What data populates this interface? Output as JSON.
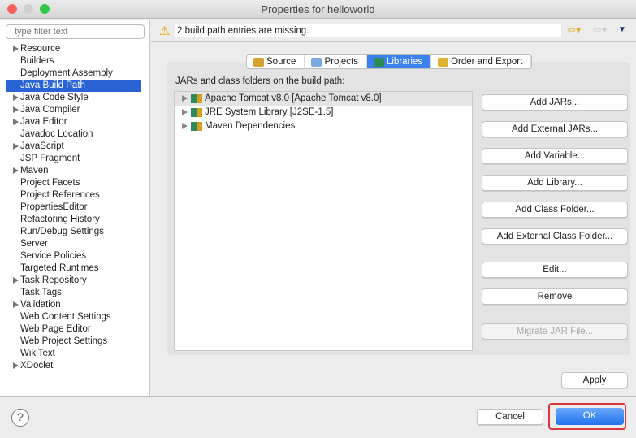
{
  "window": {
    "title": "Properties for helloworld"
  },
  "filter": {
    "placeholder": "type filter text"
  },
  "sidebar": {
    "items": [
      {
        "label": "Resource",
        "expandable": true
      },
      {
        "label": "Builders"
      },
      {
        "label": "Deployment Assembly"
      },
      {
        "label": "Java Build Path",
        "selected": true
      },
      {
        "label": "Java Code Style",
        "expandable": true
      },
      {
        "label": "Java Compiler",
        "expandable": true
      },
      {
        "label": "Java Editor",
        "expandable": true
      },
      {
        "label": "Javadoc Location"
      },
      {
        "label": "JavaScript",
        "expandable": true
      },
      {
        "label": "JSP Fragment"
      },
      {
        "label": "Maven",
        "expandable": true
      },
      {
        "label": "Project Facets"
      },
      {
        "label": "Project References"
      },
      {
        "label": "PropertiesEditor"
      },
      {
        "label": "Refactoring History"
      },
      {
        "label": "Run/Debug Settings"
      },
      {
        "label": "Server"
      },
      {
        "label": "Service Policies"
      },
      {
        "label": "Targeted Runtimes"
      },
      {
        "label": "Task Repository",
        "expandable": true
      },
      {
        "label": "Task Tags"
      },
      {
        "label": "Validation",
        "expandable": true
      },
      {
        "label": "Web Content Settings"
      },
      {
        "label": "Web Page Editor"
      },
      {
        "label": "Web Project Settings"
      },
      {
        "label": "WikiText"
      },
      {
        "label": "XDoclet",
        "expandable": true
      }
    ]
  },
  "message": {
    "text": "2 build path entries are missing.",
    "icon": "warning-icon"
  },
  "tabs": [
    {
      "label": "Source",
      "icon": "source-folder-icon"
    },
    {
      "label": "Projects",
      "icon": "folder-icon"
    },
    {
      "label": "Libraries",
      "icon": "library-icon",
      "active": true
    },
    {
      "label": "Order and Export",
      "icon": "order-icon"
    }
  ],
  "main": {
    "label": "JARs and class folders on the build path:",
    "entries": [
      "Apache Tomcat v8.0 [Apache Tomcat v8.0]",
      "JRE System Library [J2SE-1.5]",
      "Maven Dependencies"
    ],
    "buttons": [
      {
        "label": "Add JARs..."
      },
      {
        "label": "Add External JARs..."
      },
      {
        "label": "Add Variable..."
      },
      {
        "label": "Add Library..."
      },
      {
        "label": "Add Class Folder..."
      },
      {
        "label": "Add External Class Folder..."
      },
      {
        "label": "Edit..."
      },
      {
        "label": "Remove"
      },
      {
        "label": "Migrate JAR File...",
        "disabled": true
      }
    ]
  },
  "apply": "Apply",
  "cancel": "Cancel",
  "ok": "OK",
  "help": "?"
}
